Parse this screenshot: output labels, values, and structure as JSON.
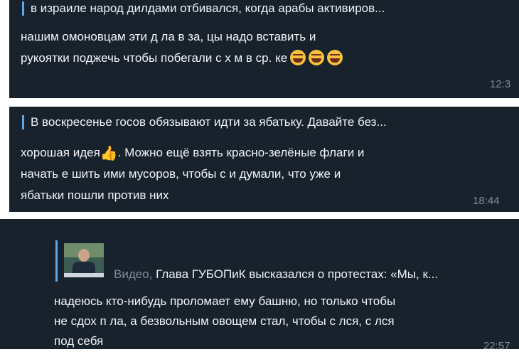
{
  "messages": [
    {
      "quote": "в израиле народ дилдами отбивался, когда арабы активиров...",
      "lines": [
        "нашим омоновцам эти д   ла в за,    цы надо вставить и",
        "рукоятки поджечь чтобы побегали с х     м в ср.  ке"
      ],
      "emojis": [
        "laughing-tears-emoji",
        "laughing-tears-emoji",
        "laughing-tears-emoji"
      ],
      "time": "12:3"
    },
    {
      "quote": "В воскресенье госов обязывают идти за ябатьку. Давайте без...",
      "line1_before": "хорошая идея",
      "line1_after": ". Можно ещё взять красно-зелёные флаги и",
      "lines_rest": [
        "начать е     шить ими мусоров, чтобы с      и думали, что уже и",
        "ябатьки пошли против них"
      ],
      "emoji": "thumbs-up-emoji",
      "time": "18:44"
    },
    {
      "quote_prefix": "Видео, ",
      "quote": "Глава ГУБОПиК высказался о протестах: «Мы, к...",
      "lines": [
        "надеюсь кто-нибудь проломает ему башню, но только чтобы",
        "не сдох п     ла, а безвольным овощем стал, чтобы с      лся, с     лся",
        "под себя"
      ],
      "time": "22:57"
    }
  ],
  "colors": {
    "bubble": "#18222d",
    "quote_bar": "#5fa8e8",
    "time": "#7d8b99",
    "text": "#f2f4f6"
  }
}
